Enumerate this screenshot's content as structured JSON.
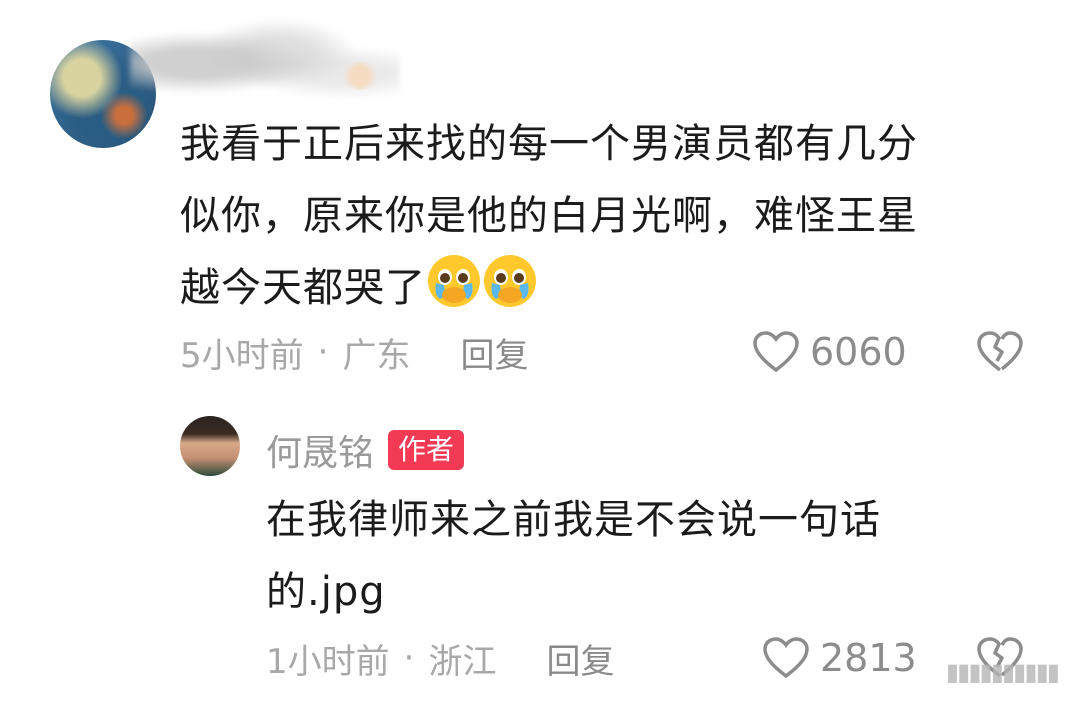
{
  "comment": {
    "lines": [
      "我看于正后来找的每一个男演员都有几分",
      "似你，原来你是他的白月光啊，难怪王星",
      "越今天都哭了"
    ],
    "time": "5小时前",
    "separator": "·",
    "location": "广东",
    "reply_label": "回复",
    "likes": "6060",
    "icons": [
      "heart-outline-icon",
      "broken-heart-icon",
      "pleading-face-emoji"
    ]
  },
  "reply": {
    "author": "何晟铭",
    "badge": "作者",
    "lines": [
      "在我律师来之前我是不会说一句话",
      "的.jpg"
    ],
    "time": "1小时前",
    "separator": "·",
    "location": "浙江",
    "reply_label": "回复",
    "likes": "2813"
  },
  "watermark": "▮▮▮▮▮▮▮▮▮▮",
  "colors": {
    "badge": "#f23a55",
    "text": "#1b1b1b",
    "meta": "#a8a8a8"
  }
}
